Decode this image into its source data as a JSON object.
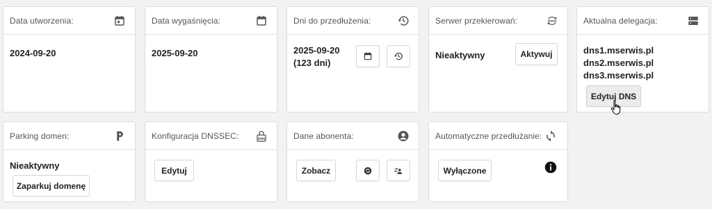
{
  "cards": {
    "created": {
      "title": "Data utworzenia:",
      "icon": "calendar-icon",
      "value": "2024-09-20"
    },
    "expires": {
      "title": "Data wygaśnięcia:",
      "icon": "calendar-icon",
      "value": "2025-09-20"
    },
    "renewal": {
      "title": "Dni do przedłużenia:",
      "icon": "history-icon",
      "date": "2025-09-20",
      "days": "(123 dni)",
      "calendar_button_icon": "calendar-icon",
      "history_button_icon": "history-icon"
    },
    "redirect": {
      "title": "Serwer przekierowań:",
      "icon": "www-refresh-icon",
      "value": "Nieaktywny",
      "button": "Aktywuj"
    },
    "delegation": {
      "title": "Aktualna delegacja:",
      "icon": "server-icon",
      "dns": [
        "dns1.mserwis.pl",
        "dns2.mserwis.pl",
        "dns3.mserwis.pl"
      ],
      "button": "Edytuj DNS"
    },
    "parking": {
      "title": "Parking domen:",
      "icon": "parking-p-icon",
      "value": "Nieaktywny",
      "button": "Zaparkuj domenę"
    },
    "dnssec": {
      "title": "Konfiguracja DNSSEC:",
      "icon": "dns-lock-icon",
      "button": "Edytuj"
    },
    "subscriber": {
      "title": "Dane abonenta:",
      "icon": "account-circle-icon",
      "button": "Zobacz"
    },
    "autorenew": {
      "title": "Automatyczne przedłużanie:",
      "icon": "autorenew-icon",
      "button": "Wyłączone",
      "info_icon": "info-icon"
    }
  },
  "colors": {
    "background": "#f2f2f2",
    "card": "#ffffff",
    "border": "#dcdcdc",
    "icon": "#555555"
  }
}
